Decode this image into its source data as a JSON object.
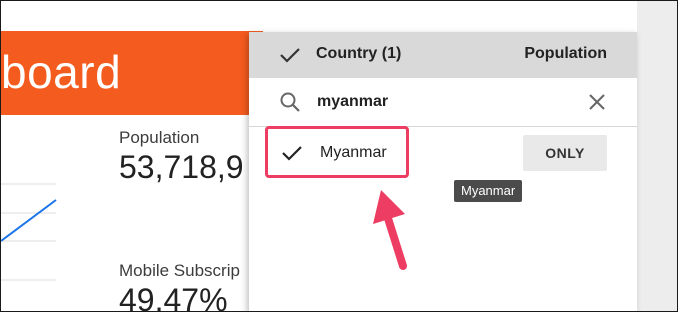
{
  "dashboard": {
    "title": "board",
    "metrics": [
      {
        "label": "Population",
        "value": "53,718,9"
      },
      {
        "label": "Mobile Subscrip",
        "value": "49.47%"
      }
    ]
  },
  "filter": {
    "header": {
      "title": "Country (1)",
      "right_label": "Population"
    },
    "search": {
      "value": "myanmar",
      "placeholder": ""
    },
    "options": [
      {
        "label": "Myanmar",
        "checked": true
      }
    ],
    "only_label": "ONLY",
    "tooltip": "Myanmar"
  },
  "colors": {
    "banner": "#f45b1f",
    "highlight": "#ee3d62",
    "chart_line": "#1a73e8",
    "header_bg": "#d9d9d9"
  }
}
